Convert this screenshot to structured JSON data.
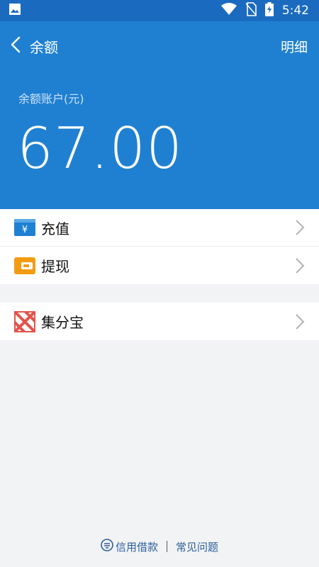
{
  "status": {
    "time": "5:42",
    "icons": [
      "image-icon",
      "wifi-icon",
      "no-sim-icon",
      "battery-charging-icon"
    ]
  },
  "nav": {
    "title": "余额",
    "detail_label": "明细"
  },
  "balance": {
    "label": "余额账户(元)",
    "amount": "67.00"
  },
  "menu": [
    {
      "label": "充值",
      "icon": "recharge-icon",
      "color": "#1f80d2"
    },
    {
      "label": "提现",
      "icon": "withdraw-wallet-icon",
      "color": "#f39c12"
    }
  ],
  "extra": [
    {
      "label": "集分宝",
      "icon": "jifenbao-icon",
      "color": "#e5534b"
    }
  ],
  "footer": {
    "left_label": "信用借款",
    "right_label": "常见问题"
  },
  "colors": {
    "header_bg": "#1f80d2",
    "status_bg": "#1a6bbf",
    "page_bg": "#f2f3f5"
  }
}
